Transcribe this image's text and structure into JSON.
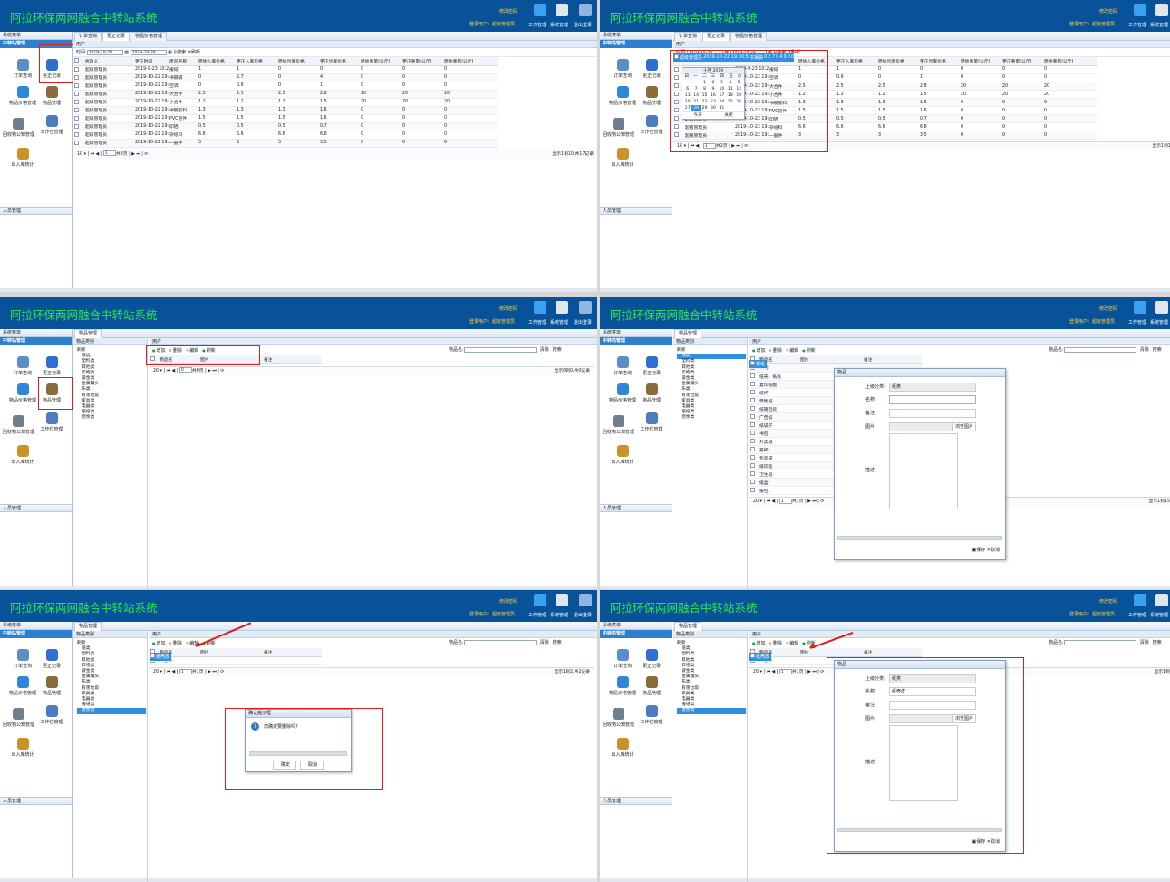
{
  "app": {
    "title": "阿拉环保两网融合中转站系统",
    "change_password": "修改密码",
    "login_user": "登录用户：超级管理员",
    "nav": [
      "工作管理",
      "系统管理",
      "退出登录"
    ],
    "colors": {
      "header": "#08529a",
      "title": "#2ce84a",
      "accent": "#e31b1b",
      "selected": "#2f8fe0"
    }
  },
  "sidebar": {
    "menu_header": "系统菜单",
    "section": "中转站管理",
    "items": [
      {
        "label": "订单查询",
        "icon": "search-icon"
      },
      {
        "label": "更正记录",
        "icon": "pencil-icon"
      },
      {
        "label": "物品价格管理",
        "icon": "rss-icon"
      },
      {
        "label": "物品管理",
        "icon": "box-icon"
      },
      {
        "label": "回收物公知管理",
        "icon": "server-icon"
      },
      {
        "label": "工作位管理",
        "icon": "user-icon"
      },
      {
        "label": "出入库统计",
        "icon": "chart-icon"
      }
    ],
    "people": "人员管理"
  },
  "records": {
    "tabs": [
      "订单查询",
      "更正记录",
      "物品价格管理"
    ],
    "ptitle": "用户",
    "time_label": "时间:",
    "date_from": "2019-10-28",
    "date_to": "2019-10-28",
    "search": "搜索",
    "refresh": "刷新",
    "columns": [
      "修改人",
      "更正时间",
      "废品名称",
      "原始入库价格",
      "更正入库价格",
      "原始出库价格",
      "更正出库价格",
      "原始重量(公斤)",
      "更正重量(公斤)",
      "原始重量(公斤)"
    ],
    "rows": [
      [
        "超级管理员",
        "2019-9-23 10:27:30",
        "报纸",
        "1",
        "1",
        "0",
        "0",
        "0",
        "0",
        "0"
      ],
      [
        "超级管理员",
        "2019-10-22 19:30:5",
        "书钢袋",
        "0",
        "2.7",
        "0",
        "4",
        "0",
        "0",
        "0"
      ],
      [
        "超级管理员",
        "2019-10-22 19:30:3",
        "空调",
        "0",
        "0.6",
        "0",
        "1",
        "0",
        "0",
        "0"
      ],
      [
        "超级管理员",
        "2019-10-22 19:30:5",
        "大合件",
        "2.5",
        "2.5",
        "2.5",
        "2.8",
        "20",
        "20",
        "20"
      ],
      [
        "超级管理员",
        "2019-10-22 19:30:5",
        "小合件",
        "1.2",
        "1.2",
        "1.2",
        "1.5",
        "20",
        "20",
        "20"
      ],
      [
        "超级管理员",
        "2019-10-22 19:30:1",
        "书钢胶料",
        "1.3",
        "1.3",
        "1.3",
        "1.6",
        "0",
        "0",
        "0"
      ],
      [
        "超级管理员",
        "2019-10-22 19:30:3",
        "PVC管件",
        "1.5",
        "1.5",
        "1.5",
        "1.6",
        "0",
        "0",
        "0"
      ],
      [
        "超级管理员",
        "2019-10-22 19:30:4",
        "印铝",
        "0.5",
        "0.5",
        "0.5",
        "0.7",
        "0",
        "0",
        "0"
      ],
      [
        "超级管理员",
        "2019-10-22 19:30:5",
        "杂纸料",
        "6.6",
        "6.6",
        "6.6",
        "6.8",
        "0",
        "0",
        "0"
      ],
      [
        "超级管理员",
        "2019-10-22 19:37:1",
        "一般件",
        "3",
        "3",
        "3",
        "3.5",
        "0",
        "0",
        "0"
      ]
    ],
    "page_size": "10",
    "page_no": "1",
    "page_total": "共2页",
    "page_info": "显示1到10,共17记录",
    "calendar": {
      "title": "十月 2019",
      "weekdays": [
        "日",
        "一",
        "二",
        "三",
        "四",
        "五",
        "六"
      ],
      "days": [
        "",
        "",
        "1",
        "2",
        "3",
        "4",
        "5",
        "6",
        "7",
        "8",
        "9",
        "10",
        "11",
        "12",
        "13",
        "14",
        "15",
        "16",
        "17",
        "18",
        "19",
        "20",
        "21",
        "22",
        "23",
        "24",
        "25",
        "26",
        "27",
        "28",
        "29",
        "30",
        "31",
        "",
        ""
      ],
      "today_day": "28",
      "today": "今天",
      "close": "关闭"
    }
  },
  "goods": {
    "tab": "物品管理",
    "category_title": "物品类别",
    "ptitle": "用户",
    "tree_root": "刷新",
    "categories": [
      "纸类",
      "塑料类",
      "其他类",
      "衣物类",
      "玻金类",
      "金属罐头",
      "布类",
      "有害垃圾",
      "家具类",
      "电器类",
      "报纸类",
      "厨余类"
    ],
    "toolbar": [
      "增加",
      "删除",
      "编辑",
      "刷新"
    ],
    "search_label": "物品名:",
    "clear": "清除",
    "search": "搜索",
    "columns": [
      "物品名",
      "图片",
      "备注"
    ],
    "page_size": "20",
    "page_no": "0",
    "page_total": "共0页",
    "page_info": "显示0到0,共0记录",
    "list_items": [
      "报纸",
      "书刊",
      "纸壳，纸板",
      "复印纸版",
      "纸杯",
      "零售纸",
      "纸箱包装",
      "广告纸",
      "纸袋子",
      "书包",
      "外卖纸",
      "茶杯",
      "包装袋",
      "纸印品",
      "卫生纸",
      "纸盒",
      "报包"
    ],
    "list_page_size": "20",
    "list_page_no": "1",
    "list_page_total": "共1页",
    "list_page_info": "显示1到15,共15记录",
    "paper_rows": [
      "纸壳皮",
      "一般件"
    ],
    "paper_page_info": "显示1到2,共2记录",
    "paper_page_total": "共1页",
    "selected_category": "纸类"
  },
  "dialogs": {
    "goods_title": "物品",
    "parent_label": "上级分类:",
    "parent_value": "纸类",
    "parent_value_3": "纸类",
    "name_label": "名称:",
    "name_value_6": "纸壳皮",
    "remark_label": "备注:",
    "pic_label": "图片:",
    "browse": "浏览图片",
    "desc_label": "描述:",
    "save": "保存",
    "cancel": "取消",
    "confirm_title": "确认提示框",
    "confirm_text": "您确定要删除吗?",
    "ok": "确定"
  }
}
